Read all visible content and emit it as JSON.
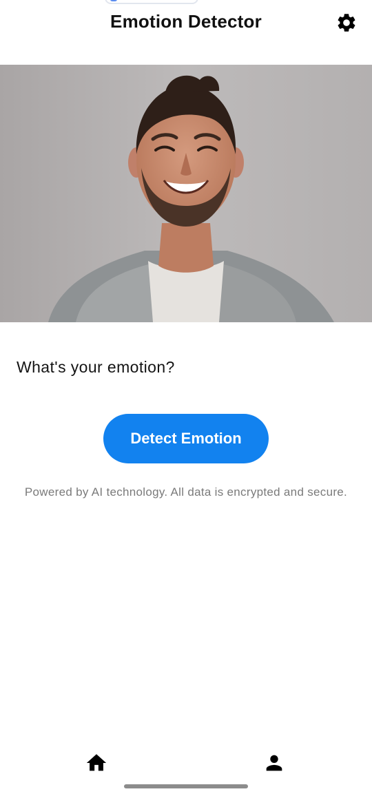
{
  "header": {
    "title": "Emotion Detector",
    "settings_icon": "gear-icon"
  },
  "main": {
    "photo_description_icon": "portrait-photo",
    "prompt": "What's your emotion?",
    "detect_button_label": "Detect Emotion",
    "footer_note": "Powered by AI technology. All data is encrypted and secure."
  },
  "bottom_nav": {
    "items": [
      {
        "icon": "home-icon"
      },
      {
        "icon": "person-icon"
      }
    ]
  },
  "colors": {
    "accent": "#1282ef",
    "title_text": "#111111",
    "muted_text": "#7a7a7a",
    "background": "#ffffff"
  }
}
